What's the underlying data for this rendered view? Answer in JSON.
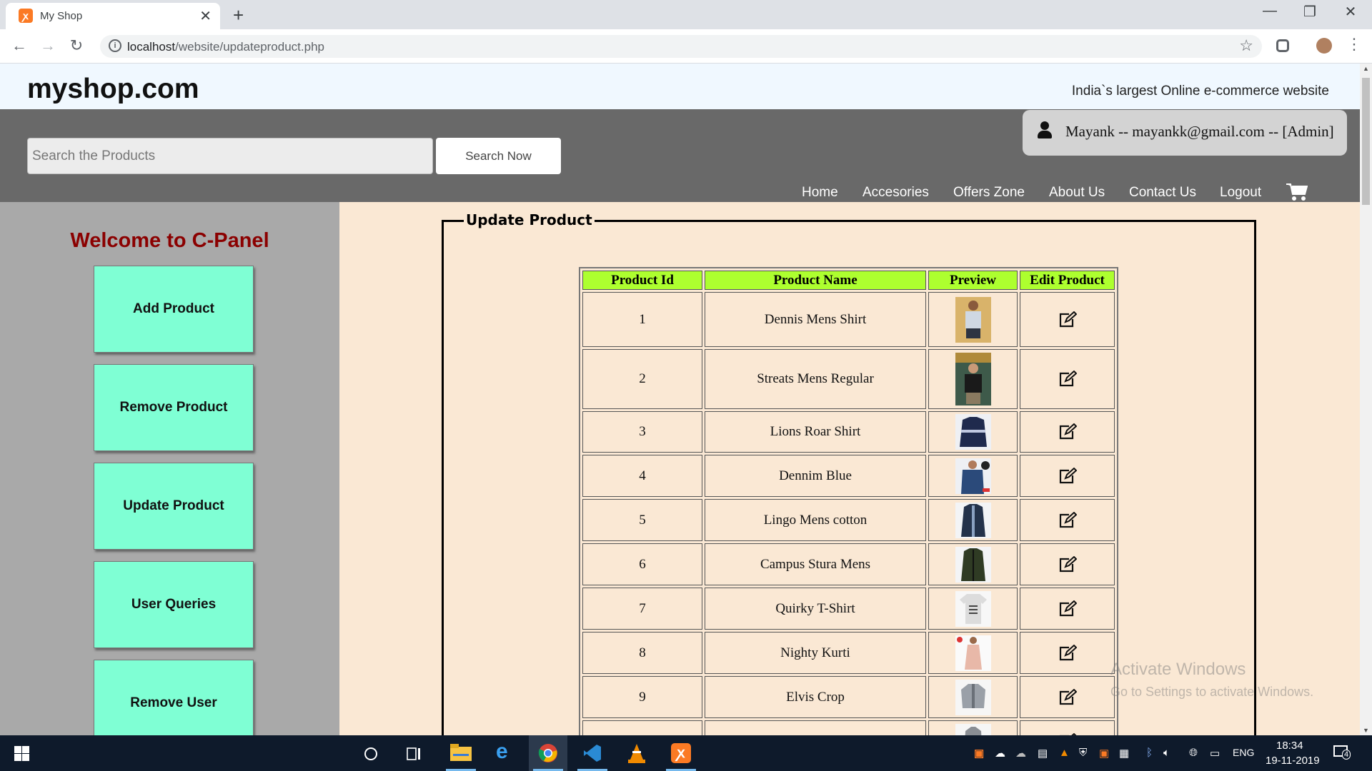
{
  "browser": {
    "tab_title": "My Shop",
    "tab_close": "✕",
    "new_tab": "+",
    "url_host": "localhost",
    "url_path": "/website/updateproduct.php",
    "window_controls": [
      "—",
      "❐",
      "✕"
    ]
  },
  "site": {
    "logo": "myshop.com",
    "tagline": "India`s largest Online e-commerce website",
    "search_placeholder": "Search the Products",
    "search_button": "Search Now",
    "user_info": "Mayank -- mayankk@gmail.com -- [Admin]",
    "nav": [
      "Home",
      "Accesories",
      "Offers Zone",
      "About Us",
      "Contact Us",
      "Logout"
    ]
  },
  "sidebar": {
    "title": "Welcome to C-Panel",
    "buttons": [
      "Add Product",
      "Remove Product",
      "Update Product",
      "User Queries",
      "Remove User"
    ]
  },
  "panel": {
    "legend": "Update Product",
    "columns": [
      "Product Id",
      "Product Name",
      "Preview",
      "Edit Product"
    ],
    "rows": [
      {
        "id": "1",
        "name": "Dennis Mens Shirt"
      },
      {
        "id": "2",
        "name": "Streats Mens Regular"
      },
      {
        "id": "3",
        "name": "Lions Roar Shirt"
      },
      {
        "id": "4",
        "name": "Dennim Blue"
      },
      {
        "id": "5",
        "name": "Lingo Mens cotton"
      },
      {
        "id": "6",
        "name": "Campus Stura Mens"
      },
      {
        "id": "7",
        "name": "Quirky T-Shirt"
      },
      {
        "id": "8",
        "name": "Nighty Kurti"
      },
      {
        "id": "9",
        "name": "Elvis Crop"
      }
    ]
  },
  "watermark": {
    "line1": "Activate Windows",
    "line2": "Go to Settings to activate Windows."
  },
  "taskbar": {
    "lang": "ENG",
    "time": "18:34",
    "date": "19-11-2019",
    "notifications": "4"
  },
  "colors": {
    "header_bg": "#696969",
    "sidebar_bg": "#a9a9a9",
    "panel_bg": "#fae8d4",
    "button_bg": "#7fffd4",
    "table_header_bg": "#adff2f",
    "title_color": "#8b0000"
  }
}
